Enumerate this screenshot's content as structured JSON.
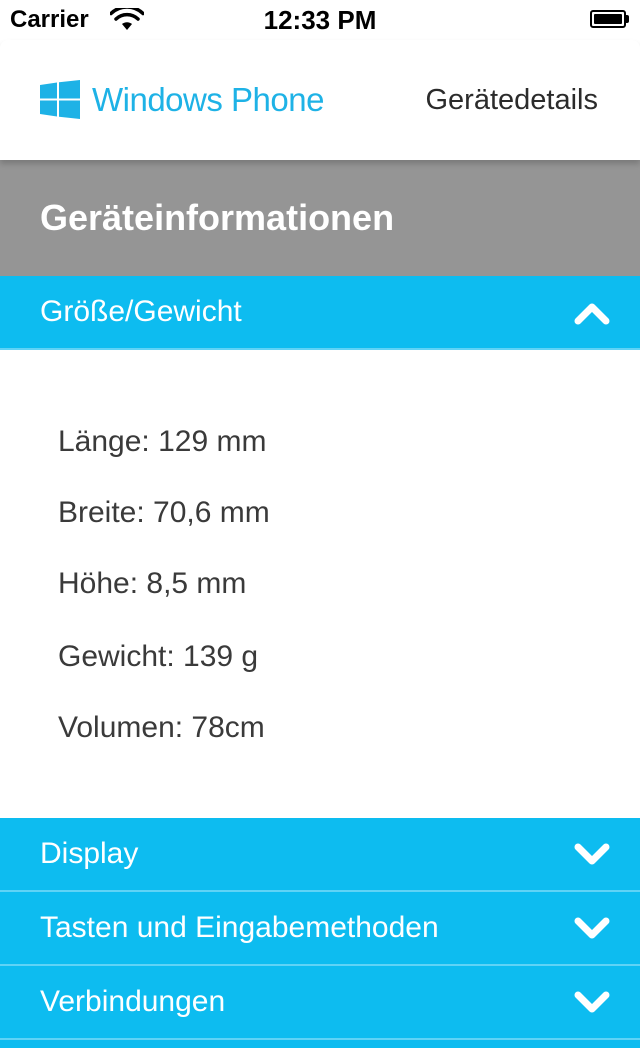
{
  "status_bar": {
    "carrier": "Carrier",
    "time": "12:33 PM",
    "icons": [
      "wifi-icon",
      "battery-icon"
    ]
  },
  "header": {
    "logo_icon": "windows-logo-icon",
    "brand": "Windows Phone",
    "title": "Gerätedetails"
  },
  "section": {
    "title": "Geräteinformationen"
  },
  "accordion": [
    {
      "label": "Größe/Gewicht",
      "expanded": true,
      "icon": "chevron-up-icon",
      "details": [
        "Länge: 129 mm",
        "Breite: 70,6 mm",
        "Höhe: 8,5 mm",
        "Gewicht: 139 g",
        "Volumen: 78cm"
      ]
    },
    {
      "label": "Display",
      "expanded": false,
      "icon": "chevron-down-icon"
    },
    {
      "label": "Tasten und Eingabemethoden",
      "expanded": false,
      "icon": "chevron-down-icon"
    },
    {
      "label": "Verbindungen",
      "expanded": false,
      "icon": "chevron-down-icon"
    }
  ],
  "colors": {
    "accent": "#0dbcf0",
    "brand_blue": "#1eb2e6",
    "section_gray": "#959595"
  }
}
